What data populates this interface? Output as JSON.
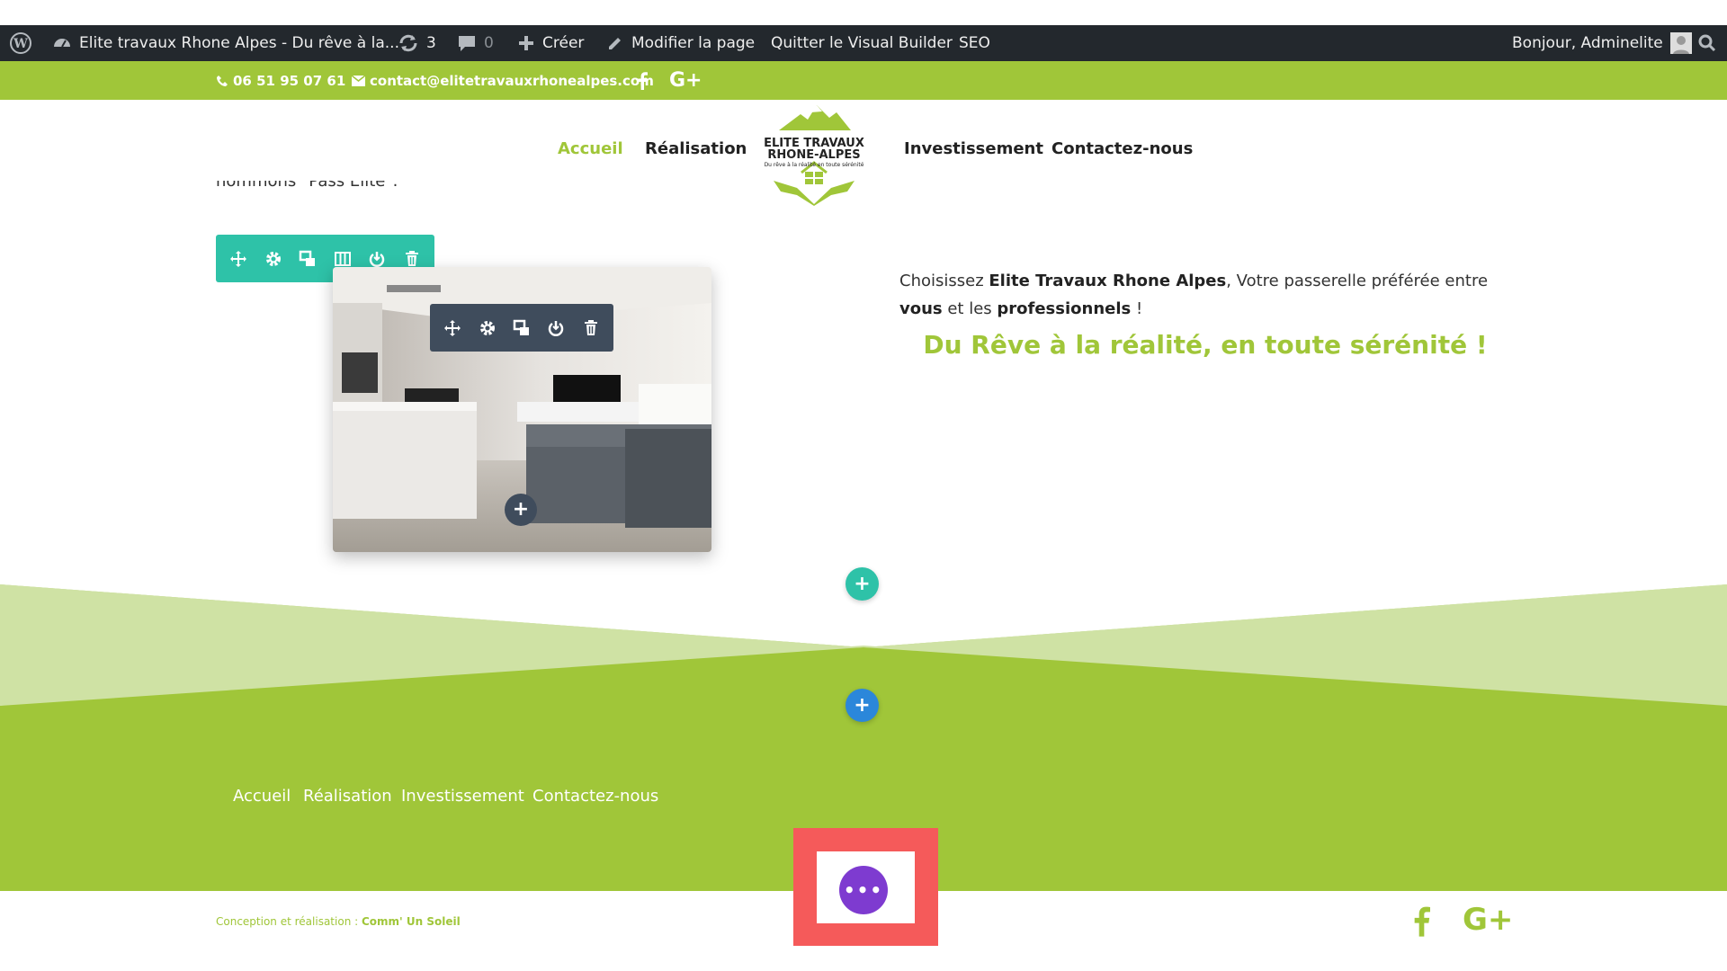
{
  "admin_bar": {
    "site_title": "Elite travaux Rhone Alpes - Du rêve à la...",
    "updates_count": "3",
    "comments_count": "0",
    "create_label": "Créer",
    "edit_page_label": "Modifier la page",
    "quit_builder_label": "Quitter le Visual Builder",
    "seo_label": "SEO",
    "greeting": "Bonjour, Adminelite"
  },
  "top_bar": {
    "phone": "06 51 95 07 61",
    "email": "contact@elitetravauxrhonealpes.com"
  },
  "nav": {
    "items": [
      "Accueil",
      "Réalisation",
      "Investissement",
      "Contactez-nous"
    ],
    "active_index": 0
  },
  "logo": {
    "line1": "ELITE TRAVAUX",
    "line2": "RHONE-ALPES",
    "tagline": "Du rêve à la réalité en toute sérénité"
  },
  "content": {
    "cut_text": "nommons \"Pass Elite\".",
    "para_1": "Choisissez ",
    "para_brand": "Elite Travaux Rhone Alpes",
    "para_2": ", Votre passerelle préférée entre ",
    "para_you": "vous",
    "para_3": " et les ",
    "para_pros": "professionnels",
    "para_4": " !",
    "slogan": "Du Rêve à la réalité, en toute sérénité !"
  },
  "footer": {
    "links": [
      "Accueil",
      "Réalisation",
      "Investissement",
      "Contactez-nous"
    ],
    "credit_prefix": "Conception et réalisation : ",
    "credit_name": "Comm' Un Soleil"
  },
  "colors": {
    "green": "#a0c639",
    "light_green": "#cfe2a4",
    "teal": "#2ec2a8",
    "blue": "#2b87da",
    "purple": "#7e3bd0",
    "highlight": "#f55a5a",
    "admin_bg": "#23282d"
  }
}
